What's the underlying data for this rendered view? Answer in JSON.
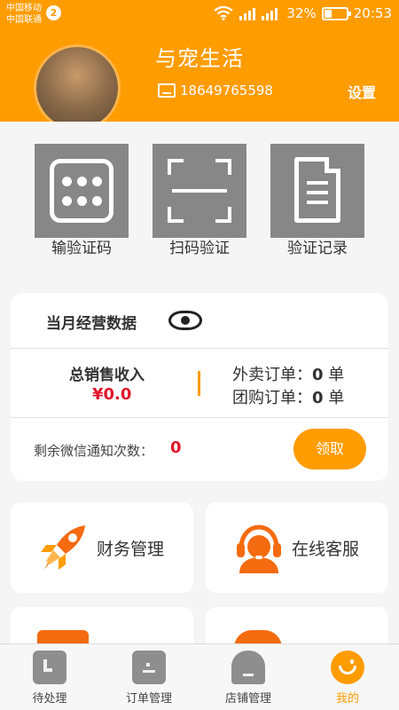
{
  "status_bar": {
    "carrier_1": "中国移动",
    "carrier_2": "中国联通",
    "notification_count": "2",
    "network": "4G",
    "battery": "32%",
    "time": "20:53"
  },
  "profile": {
    "shop_name": "与宠生活",
    "phone": "18649765598",
    "settings_label": "设置"
  },
  "tools": [
    {
      "label": "输验证码",
      "icon": "keypad-icon"
    },
    {
      "label": "扫码验证",
      "icon": "scan-icon"
    },
    {
      "label": "验证记录",
      "icon": "document-icon"
    }
  ],
  "business": {
    "title": "当月经营数据",
    "total_sales_label": "总销售收入",
    "total_sales_value": "¥0.0",
    "takeout_label": "外卖订单：",
    "takeout_count": "0",
    "group_label": "团购订单：",
    "group_count": "0",
    "unit": "单",
    "wechat_notice_label": "剩余微信通知次数：",
    "wechat_notice_count": "0",
    "claim_button": "领取"
  },
  "menu": [
    {
      "label": "财务管理",
      "icon": "rocket-icon"
    },
    {
      "label": "在线客服",
      "icon": "customer-service-icon"
    }
  ],
  "tabbar": [
    {
      "label": "待处理",
      "icon": "pending-icon"
    },
    {
      "label": "订单管理",
      "icon": "orders-icon"
    },
    {
      "label": "店铺管理",
      "icon": "store-icon"
    },
    {
      "label": "我的",
      "icon": "profile-smile-icon"
    }
  ],
  "colors": {
    "accent": "#ff9c00",
    "price_red": "#e0162b",
    "tile_gray": "#878787"
  }
}
